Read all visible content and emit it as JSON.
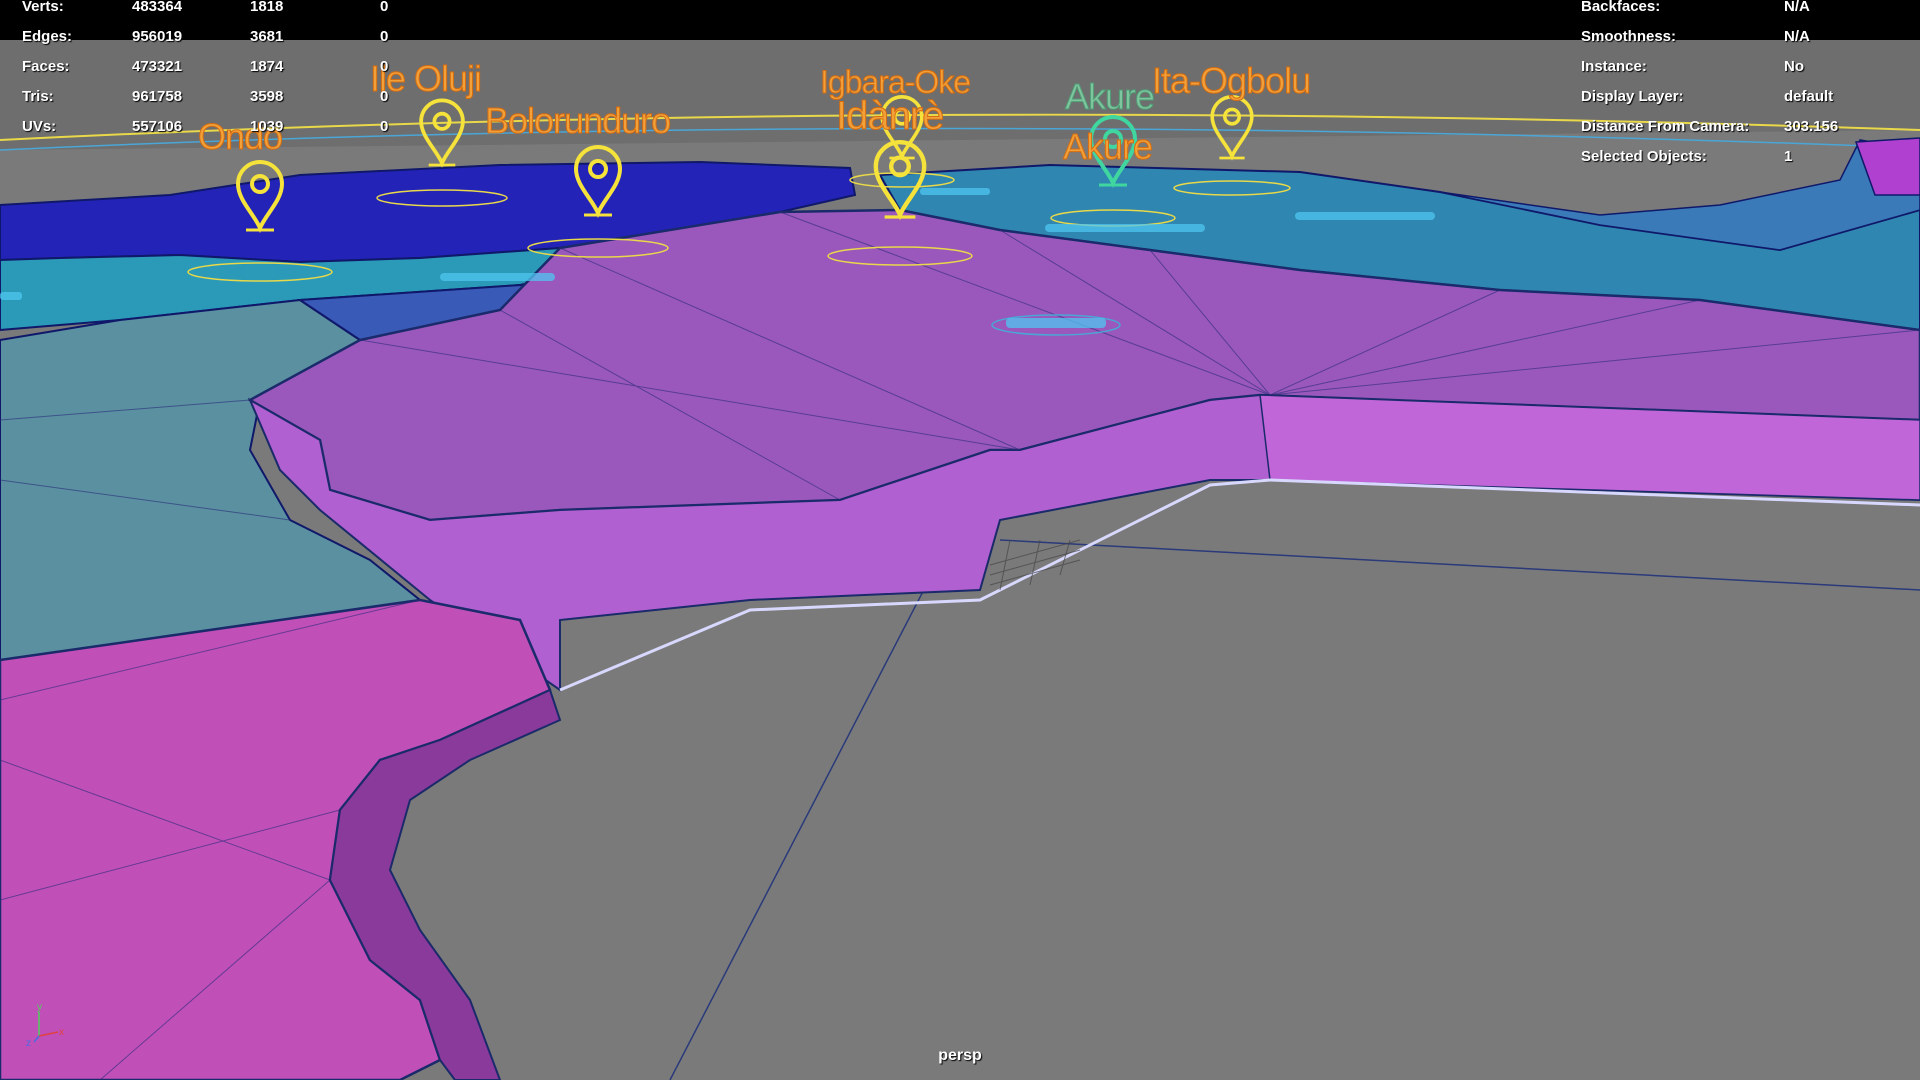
{
  "hud_left": [
    {
      "label": "Verts:",
      "total": "483364",
      "selected": "1818",
      "component": "0"
    },
    {
      "label": "Edges:",
      "total": "956019",
      "selected": "3681",
      "component": "0"
    },
    {
      "label": "Faces:",
      "total": "473321",
      "selected": "1874",
      "component": "0"
    },
    {
      "label": "Tris:",
      "total": "961758",
      "selected": "3598",
      "component": "0"
    },
    {
      "label": "UVs:",
      "total": "557106",
      "selected": "1039",
      "component": "0"
    }
  ],
  "hud_right": [
    {
      "label": "Backfaces:",
      "value": "N/A"
    },
    {
      "label": "Smoothness:",
      "value": "N/A"
    },
    {
      "label": "Instance:",
      "value": "No"
    },
    {
      "label": "Display Layer:",
      "value": "default"
    },
    {
      "label": "Distance From Camera:",
      "value": "303.156"
    },
    {
      "label": "Selected Objects:",
      "value": "1"
    }
  ],
  "places": {
    "ondo": "Ondo",
    "ile_oluji": "Ile Oluji",
    "bolorunduro": "Bolorunduro",
    "igbara_oke": "Igbara-Oke",
    "idanre": "Idànrè",
    "akure_top": "Akure",
    "akure": "Akure",
    "ita_ogbolu": "Ita-Ogbolu"
  },
  "camera_name": "persp",
  "axis": {
    "x": "x",
    "y": "y",
    "z": "z"
  },
  "colors": {
    "background": "#7a7a7a",
    "marker_yellow": "#f5e23a",
    "marker_selected": "#3fd6a0",
    "label_orange": "#f2a13a",
    "region_purple": "#a65cc4",
    "region_magenta": "#c060c0",
    "region_blue": "#2222b8",
    "region_teal": "#4a96b4",
    "wire": "#1a2a6a"
  }
}
